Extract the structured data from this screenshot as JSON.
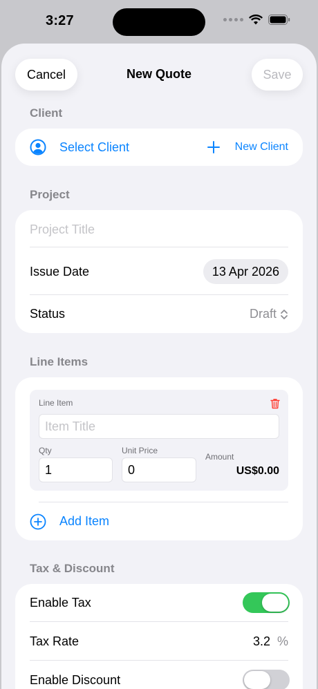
{
  "status_bar": {
    "time": "3:27"
  },
  "nav": {
    "cancel_label": "Cancel",
    "title": "New Quote",
    "save_label": "Save"
  },
  "client": {
    "header": "Client",
    "select_label": "Select Client",
    "new_label": "New Client"
  },
  "project": {
    "header": "Project",
    "title_placeholder": "Project Title",
    "issue_date_label": "Issue Date",
    "issue_date_value": "13 Apr 2026",
    "status_label": "Status",
    "status_value": "Draft"
  },
  "line_items": {
    "header": "Line Items",
    "item_label": "Line Item",
    "item_title_placeholder": "Item Title",
    "qty_label": "Qty",
    "qty_value": "1",
    "unit_price_label": "Unit Price",
    "unit_price_value": "0",
    "amount_label": "Amount",
    "amount_value": "US$0.00",
    "add_item_label": "Add Item"
  },
  "tax_discount": {
    "header": "Tax & Discount",
    "enable_tax_label": "Enable Tax",
    "enable_tax_on": true,
    "tax_rate_label": "Tax Rate",
    "tax_rate_value": "3.2",
    "tax_rate_unit": "%",
    "enable_discount_label": "Enable Discount",
    "enable_discount_on": false
  },
  "colors": {
    "accent": "#0a84ff",
    "toggle_on": "#34c759",
    "toggle_off": "#d1d1d6",
    "delete": "#ff3b30"
  }
}
